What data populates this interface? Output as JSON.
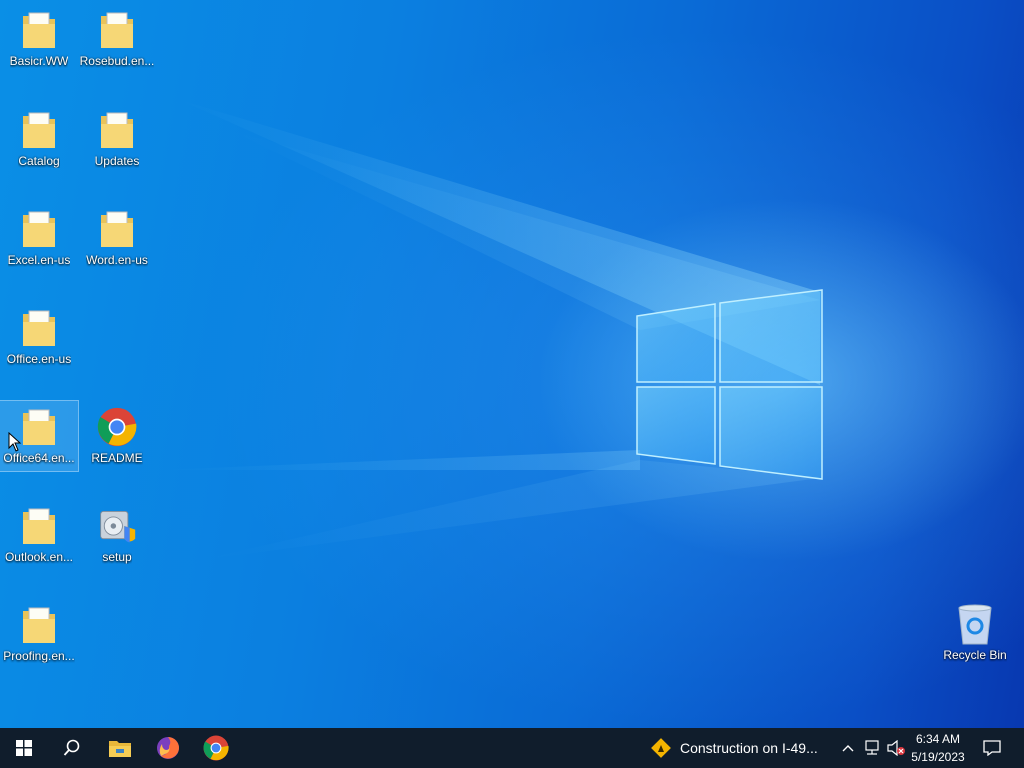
{
  "desktop_icons": [
    {
      "label": "Basicr.WW",
      "icon": "folder-icon"
    },
    {
      "label": "Rosebud.en...",
      "icon": "folder-icon"
    },
    {
      "label": "Catalog",
      "icon": "folder-icon"
    },
    {
      "label": "Updates",
      "icon": "folder-icon"
    },
    {
      "label": "Excel.en-us",
      "icon": "folder-icon"
    },
    {
      "label": "Word.en-us",
      "icon": "folder-icon"
    },
    {
      "label": "Office.en-us",
      "icon": "folder-icon"
    },
    {
      "label": "Office64.en...",
      "icon": "folder-icon"
    },
    {
      "label": "README",
      "icon": "chrome-icon"
    },
    {
      "label": "Outlook.en...",
      "icon": "folder-icon"
    },
    {
      "label": "setup",
      "icon": "setup-icon"
    },
    {
      "label": "Proofing.en...",
      "icon": "folder-icon"
    },
    {
      "label": "Recycle Bin",
      "icon": "recycle-bin-icon"
    }
  ],
  "taskbar": {
    "items": [
      "start-icon",
      "search-icon",
      "file-explorer-icon",
      "firefox-icon",
      "chrome-icon"
    ],
    "news": {
      "label": "Construction on I-49...",
      "icon": "road-work-icon"
    },
    "tray": [
      "chevron-up-icon",
      "network-icon",
      "volume-muted-icon"
    ],
    "clock": {
      "time": "6:34 AM",
      "date": "5/19/2023"
    },
    "notification_icon": "notification-icon"
  },
  "colors": {
    "taskbar": "#101d2c",
    "desktop_accent": "#0a8fe6"
  }
}
